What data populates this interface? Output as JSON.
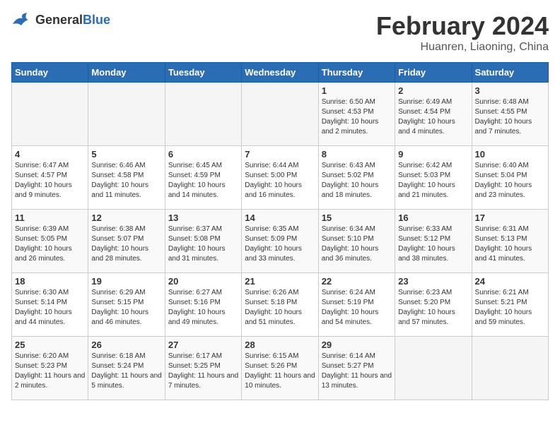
{
  "logo": {
    "general": "General",
    "blue": "Blue"
  },
  "title": "February 2024",
  "subtitle": "Huanren, Liaoning, China",
  "weekdays": [
    "Sunday",
    "Monday",
    "Tuesday",
    "Wednesday",
    "Thursday",
    "Friday",
    "Saturday"
  ],
  "weeks": [
    [
      {
        "day": "",
        "detail": ""
      },
      {
        "day": "",
        "detail": ""
      },
      {
        "day": "",
        "detail": ""
      },
      {
        "day": "",
        "detail": ""
      },
      {
        "day": "1",
        "detail": "Sunrise: 6:50 AM\nSunset: 4:53 PM\nDaylight: 10 hours and 2 minutes."
      },
      {
        "day": "2",
        "detail": "Sunrise: 6:49 AM\nSunset: 4:54 PM\nDaylight: 10 hours and 4 minutes."
      },
      {
        "day": "3",
        "detail": "Sunrise: 6:48 AM\nSunset: 4:55 PM\nDaylight: 10 hours and 7 minutes."
      }
    ],
    [
      {
        "day": "4",
        "detail": "Sunrise: 6:47 AM\nSunset: 4:57 PM\nDaylight: 10 hours and 9 minutes."
      },
      {
        "day": "5",
        "detail": "Sunrise: 6:46 AM\nSunset: 4:58 PM\nDaylight: 10 hours and 11 minutes."
      },
      {
        "day": "6",
        "detail": "Sunrise: 6:45 AM\nSunset: 4:59 PM\nDaylight: 10 hours and 14 minutes."
      },
      {
        "day": "7",
        "detail": "Sunrise: 6:44 AM\nSunset: 5:00 PM\nDaylight: 10 hours and 16 minutes."
      },
      {
        "day": "8",
        "detail": "Sunrise: 6:43 AM\nSunset: 5:02 PM\nDaylight: 10 hours and 18 minutes."
      },
      {
        "day": "9",
        "detail": "Sunrise: 6:42 AM\nSunset: 5:03 PM\nDaylight: 10 hours and 21 minutes."
      },
      {
        "day": "10",
        "detail": "Sunrise: 6:40 AM\nSunset: 5:04 PM\nDaylight: 10 hours and 23 minutes."
      }
    ],
    [
      {
        "day": "11",
        "detail": "Sunrise: 6:39 AM\nSunset: 5:05 PM\nDaylight: 10 hours and 26 minutes."
      },
      {
        "day": "12",
        "detail": "Sunrise: 6:38 AM\nSunset: 5:07 PM\nDaylight: 10 hours and 28 minutes."
      },
      {
        "day": "13",
        "detail": "Sunrise: 6:37 AM\nSunset: 5:08 PM\nDaylight: 10 hours and 31 minutes."
      },
      {
        "day": "14",
        "detail": "Sunrise: 6:35 AM\nSunset: 5:09 PM\nDaylight: 10 hours and 33 minutes."
      },
      {
        "day": "15",
        "detail": "Sunrise: 6:34 AM\nSunset: 5:10 PM\nDaylight: 10 hours and 36 minutes."
      },
      {
        "day": "16",
        "detail": "Sunrise: 6:33 AM\nSunset: 5:12 PM\nDaylight: 10 hours and 38 minutes."
      },
      {
        "day": "17",
        "detail": "Sunrise: 6:31 AM\nSunset: 5:13 PM\nDaylight: 10 hours and 41 minutes."
      }
    ],
    [
      {
        "day": "18",
        "detail": "Sunrise: 6:30 AM\nSunset: 5:14 PM\nDaylight: 10 hours and 44 minutes."
      },
      {
        "day": "19",
        "detail": "Sunrise: 6:29 AM\nSunset: 5:15 PM\nDaylight: 10 hours and 46 minutes."
      },
      {
        "day": "20",
        "detail": "Sunrise: 6:27 AM\nSunset: 5:16 PM\nDaylight: 10 hours and 49 minutes."
      },
      {
        "day": "21",
        "detail": "Sunrise: 6:26 AM\nSunset: 5:18 PM\nDaylight: 10 hours and 51 minutes."
      },
      {
        "day": "22",
        "detail": "Sunrise: 6:24 AM\nSunset: 5:19 PM\nDaylight: 10 hours and 54 minutes."
      },
      {
        "day": "23",
        "detail": "Sunrise: 6:23 AM\nSunset: 5:20 PM\nDaylight: 10 hours and 57 minutes."
      },
      {
        "day": "24",
        "detail": "Sunrise: 6:21 AM\nSunset: 5:21 PM\nDaylight: 10 hours and 59 minutes."
      }
    ],
    [
      {
        "day": "25",
        "detail": "Sunrise: 6:20 AM\nSunset: 5:23 PM\nDaylight: 11 hours and 2 minutes."
      },
      {
        "day": "26",
        "detail": "Sunrise: 6:18 AM\nSunset: 5:24 PM\nDaylight: 11 hours and 5 minutes."
      },
      {
        "day": "27",
        "detail": "Sunrise: 6:17 AM\nSunset: 5:25 PM\nDaylight: 11 hours and 7 minutes."
      },
      {
        "day": "28",
        "detail": "Sunrise: 6:15 AM\nSunset: 5:26 PM\nDaylight: 11 hours and 10 minutes."
      },
      {
        "day": "29",
        "detail": "Sunrise: 6:14 AM\nSunset: 5:27 PM\nDaylight: 11 hours and 13 minutes."
      },
      {
        "day": "",
        "detail": ""
      },
      {
        "day": "",
        "detail": ""
      }
    ]
  ]
}
